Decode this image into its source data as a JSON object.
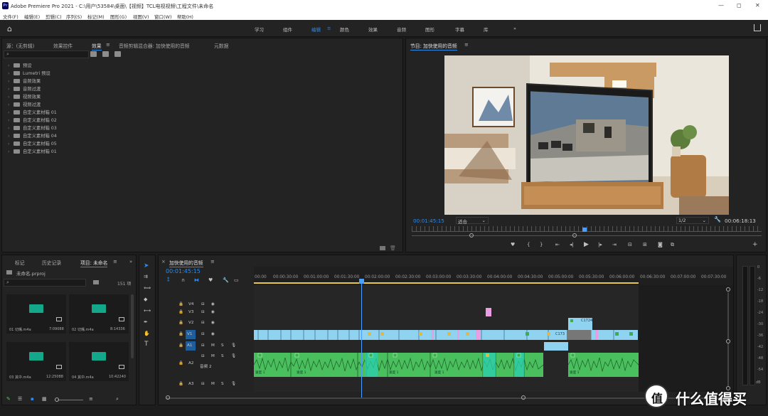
{
  "app": {
    "title": "Adobe Premiere Pro 2021 - C:\\用户\\53584\\桌面\\【视频】TCL电视视频\\工程文件\\未命名",
    "logo_text": "Pr"
  },
  "menu": [
    "文件(F)",
    "编辑(E)",
    "剪辑(C)",
    "序列(S)",
    "标记(M)",
    "图形(G)",
    "视图(V)",
    "窗口(W)",
    "帮助(H)"
  ],
  "workspaces": [
    "学习",
    "组件",
    "编辑",
    "颜色",
    "效果",
    "音频",
    "图形",
    "字幕",
    "库"
  ],
  "workspace_active": "编辑",
  "effects_panel": {
    "tabs": [
      "源：(无剪辑)",
      "效果控件",
      "效果",
      "音频剪辑混合器: 加快使用的音频",
      "元数据"
    ],
    "active_tab": "效果",
    "items": [
      "预设",
      "Lumetri 预设",
      "音频效果",
      "音频过渡",
      "视频效果",
      "视频过渡",
      "自定义素材箱 01",
      "自定义素材箱 02",
      "自定义素材箱 03",
      "自定义素材箱 04",
      "自定义素材箱 05",
      "自定义素材箱 01"
    ]
  },
  "program_monitor": {
    "title": "节目: 加快使用的音频",
    "timecode": "00:01:45:15",
    "fit": "适合",
    "resolution": "1/2",
    "duration": "00:06:18:13"
  },
  "project_panel": {
    "tabs": [
      "标记",
      "历史记录",
      "项目: 未命名"
    ],
    "active_tab": "项目: 未命名",
    "file": "未命名.prproj",
    "count": "151 项",
    "items": [
      {
        "name": "01 切嘴.m4a",
        "duration": "7:09088"
      },
      {
        "name": "02 切嘴.m4a",
        "duration": "8:14336"
      },
      {
        "name": "03 其中.m4a",
        "duration": "12:25088"
      },
      {
        "name": "04 其中.m4a",
        "duration": "10:42240"
      }
    ]
  },
  "timeline": {
    "title": "加快使用的音频",
    "timecode": "00:01:45:15",
    "ruler": [
      "00:00",
      "00:00:30:00",
      "00:01:00:00",
      "00:01:30:00",
      "00:02:00:00",
      "00:02:30:00",
      "00:03:00:00",
      "00:03:30:00",
      "00:04:00:00",
      "00:04:30:00",
      "00:05:00:00",
      "00:05:30:00",
      "00:06:00:00",
      "00:06:30:00",
      "00:07:00:00",
      "00:07:30:00"
    ],
    "tracks": [
      "V4",
      "V3",
      "V2",
      "V1",
      "A1",
      "A2",
      "A3"
    ],
    "a2_name": "音频 2",
    "clip_labels": [
      "C173",
      "C1724"
    ],
    "audio_clip_label": "速度 1"
  },
  "audio_meter": {
    "scale": [
      "0",
      "-6",
      "-12",
      "-18",
      "-24",
      "-30",
      "-36",
      "-42",
      "-48",
      "-54",
      "dB"
    ]
  },
  "watermark": {
    "text": "什么值得买",
    "glyph": "值"
  },
  "colors": {
    "accent": "#2d8ceb",
    "video_clip": "#8fd3f0",
    "audio_clip": "#49c05d",
    "playhead": "#4a9eff",
    "background": "#1d1d1d",
    "panel": "#232323"
  }
}
